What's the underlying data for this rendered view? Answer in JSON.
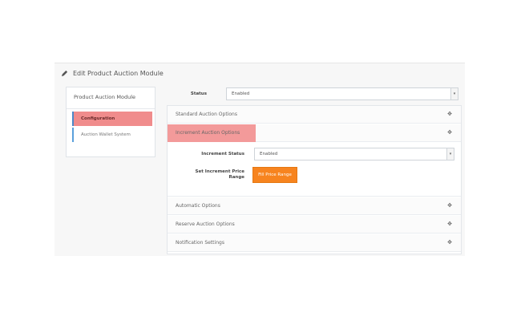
{
  "header": {
    "title": "Edit Product Auction Module",
    "icon": "pencil-icon"
  },
  "sidebar": {
    "title": "Product Auction Module",
    "items": [
      {
        "label": "Configuration",
        "active": true
      },
      {
        "label": "Auction Wallet System",
        "active": false
      }
    ]
  },
  "status": {
    "label": "Status",
    "value": "Enabled"
  },
  "accordion": {
    "sections": [
      {
        "label": "Standard Auction Options",
        "icon": "move-icon"
      },
      {
        "label": "Increment Auction Options",
        "icon": "move-icon"
      },
      {
        "label": "Automatic Options",
        "icon": "move-icon"
      },
      {
        "label": "Reserve Auction Options",
        "icon": "move-icon"
      },
      {
        "label": "Notification Settings",
        "icon": "move-icon"
      }
    ],
    "increment": {
      "status_label": "Increment Status",
      "status_value": "Enabled",
      "range_label_line1": "Set Increment Price",
      "range_label_line2": "Range",
      "button_label": "Fill Price Range"
    }
  },
  "colors": {
    "highlight": "#f39a9a",
    "accent_blue": "#4b88c8",
    "button_orange": "#f7841f"
  }
}
